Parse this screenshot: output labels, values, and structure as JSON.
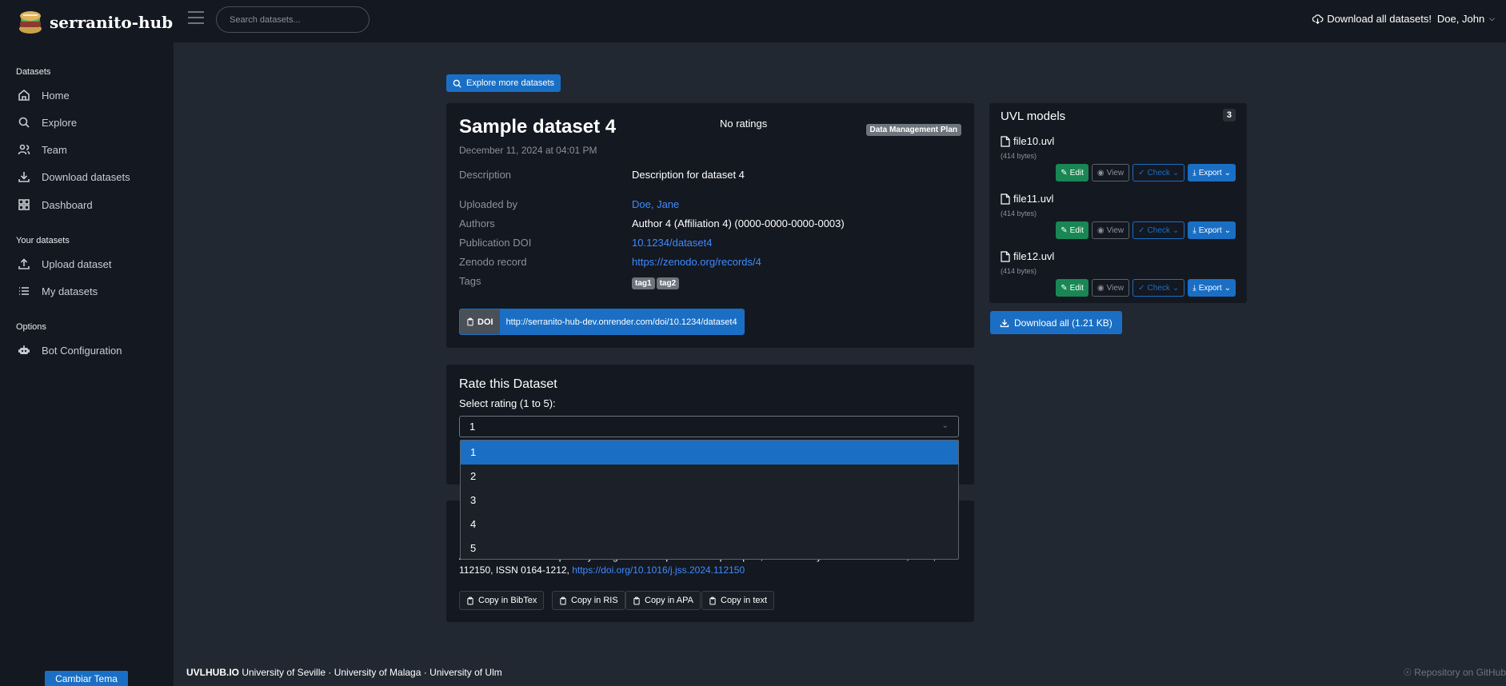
{
  "brand": {
    "name": "serranito-hub"
  },
  "sidebar": {
    "sections": [
      {
        "label": "Datasets"
      },
      {
        "label": "Your datasets"
      },
      {
        "label": "Options"
      }
    ],
    "items": [
      {
        "label": "Home",
        "icon": "home-icon"
      },
      {
        "label": "Explore",
        "icon": "search-icon"
      },
      {
        "label": "Team",
        "icon": "users-icon"
      },
      {
        "label": "Download datasets",
        "icon": "download-icon"
      },
      {
        "label": "Dashboard",
        "icon": "grid-icon"
      },
      {
        "label": "Upload dataset",
        "icon": "upload-icon"
      },
      {
        "label": "My datasets",
        "icon": "list-icon"
      },
      {
        "label": "Bot Configuration",
        "icon": "robot-icon"
      }
    ],
    "theme_button": "Cambiar Tema"
  },
  "topbar": {
    "search_placeholder": "Search datasets...",
    "download_all": "Download all datasets!",
    "user": "Doe, John"
  },
  "main": {
    "explore_button": "Explore more datasets",
    "dataset": {
      "title": "Sample dataset 4",
      "ratings": "No ratings",
      "dmp_badge": "Data Management Plan",
      "date": "December 11, 2024 at 04:01 PM",
      "rows": [
        {
          "label": "Description",
          "value": "Description for dataset 4"
        },
        {
          "label": "Uploaded by",
          "value": "Doe, Jane"
        },
        {
          "label": "Authors",
          "value": "Author 4 (Affiliation 4) (0000-0000-0000-0003)"
        },
        {
          "label": "Publication DOI",
          "value": "10.1234/dataset4"
        },
        {
          "label": "Zenodo record",
          "value": "https://zenodo.org/records/4"
        },
        {
          "label": "Tags",
          "value": ""
        }
      ],
      "tags": [
        "tag1",
        "tag2"
      ],
      "doi_label": "DOI",
      "doi_url": "http://serranito-hub-dev.onrender.com/doi/10.1234/dataset4"
    },
    "rate": {
      "title": "Rate this Dataset",
      "select_label": "Select rating (1 to 5):",
      "selected": "1",
      "options": [
        "1",
        "2",
        "3",
        "4",
        "5"
      ]
    },
    "cite": {
      "text_line1": "A feature model data repository using UVL and open science principles, Journal of Systems and Software, 2024,",
      "text_line2": "112150, ISSN 0164-1212, ",
      "link": "https://doi.org/10.1016/j.jss.2024.112150",
      "buttons": [
        "Copy in BibTex",
        "Copy in RIS",
        "Copy in APA",
        "Copy in text"
      ]
    },
    "uvl": {
      "title": "UVL models",
      "count": "3",
      "files": [
        {
          "name": "file10.uvl",
          "size": "(414 bytes)"
        },
        {
          "name": "file11.uvl",
          "size": "(414 bytes)"
        },
        {
          "name": "file12.uvl",
          "size": "(414 bytes)"
        }
      ],
      "btn_edit": "Edit",
      "btn_view": "View",
      "btn_check": "Check",
      "btn_export": "Export",
      "download_all": "Download all (1.21 KB)"
    }
  },
  "footer": {
    "brand": "UVLHUB.IO",
    "text": " University of Seville · University of Malaga · University of Ulm",
    "repo": "Repository on GitHub"
  },
  "colors": {
    "accent": "#1a6fc4",
    "success": "#198754",
    "bg": "#222831",
    "panel": "#141821"
  }
}
